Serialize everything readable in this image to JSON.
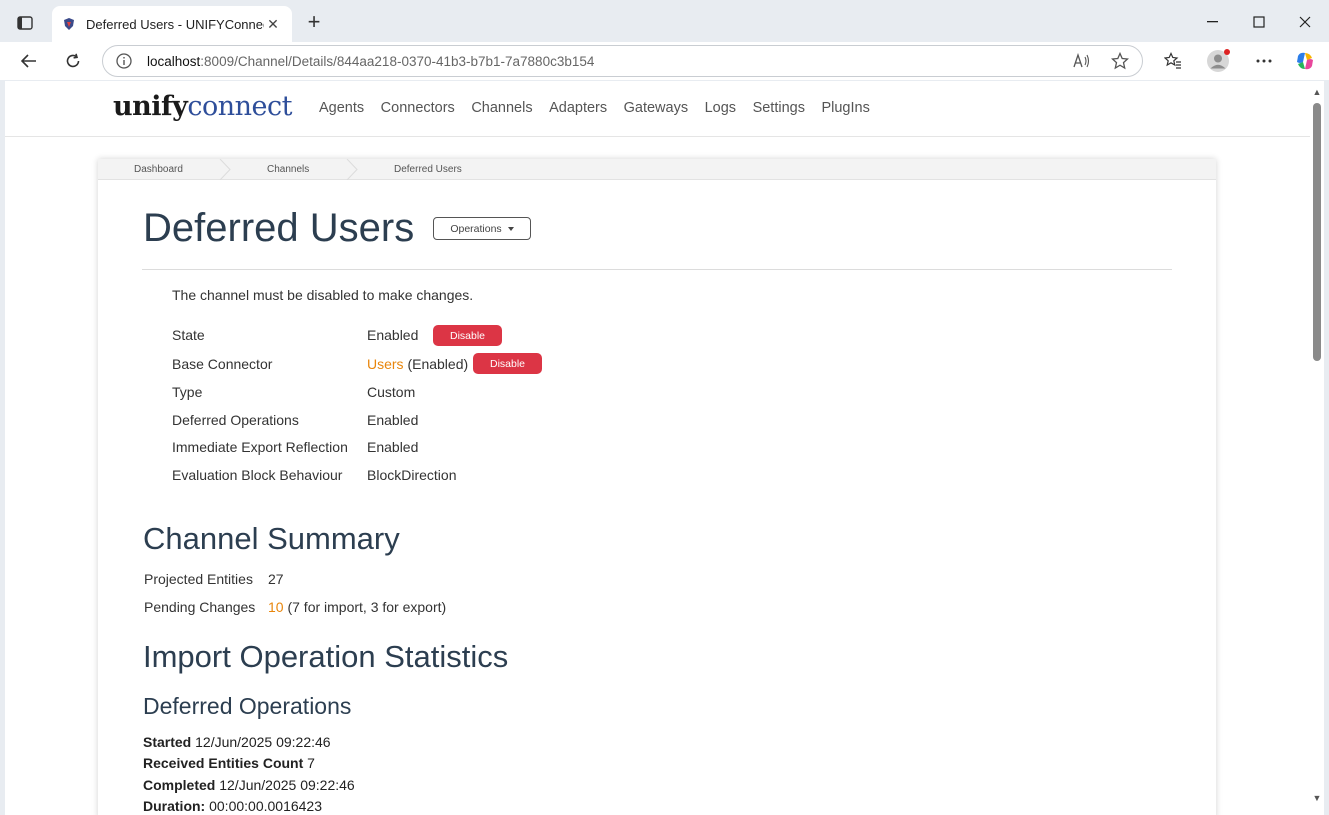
{
  "browser": {
    "tab_title": "Deferred Users - UNIFYConnect",
    "tab_close": "✕",
    "new_tab": "+",
    "url_host": "localhost",
    "url_path": ":8009/Channel/Details/844aa218-0370-41b3-b7b1-7a7880c3b154"
  },
  "site": {
    "logo_part1": "unify",
    "logo_part2": "connect",
    "nav": [
      "Agents",
      "Connectors",
      "Channels",
      "Adapters",
      "Gateways",
      "Logs",
      "Settings",
      "PlugIns"
    ]
  },
  "breadcrumb": [
    "Dashboard",
    "Channels",
    "Deferred Users"
  ],
  "page": {
    "title": "Deferred Users",
    "operations_label": "Operations",
    "notice": "The channel must be disabled to make changes."
  },
  "properties": {
    "state_label": "State",
    "state_value": "Enabled",
    "state_button": "Disable",
    "base_connector_label": "Base Connector",
    "base_connector_link": "Users",
    "base_connector_status": "(Enabled)",
    "base_connector_button": "Disable",
    "type_label": "Type",
    "type_value": "Custom",
    "deferred_ops_label": "Deferred Operations",
    "deferred_ops_value": "Enabled",
    "immediate_export_label": "Immediate Export Reflection",
    "immediate_export_value": "Enabled",
    "eval_block_label": "Evaluation Block Behaviour",
    "eval_block_value": "BlockDirection"
  },
  "summary": {
    "heading": "Channel Summary",
    "projected_label": "Projected Entities",
    "projected_value": "27",
    "pending_label": "Pending Changes",
    "pending_value": "10",
    "pending_detail": "(7 for import, 3 for export)"
  },
  "import_stats": {
    "heading": "Import Operation Statistics",
    "subheading": "Deferred Operations",
    "started_label": "Started",
    "started_value": "12/Jun/2025 09:22:46",
    "received_label": "Received Entities Count",
    "received_value": "7",
    "completed_label": "Completed",
    "completed_value": "12/Jun/2025 09:22:46",
    "duration_label": "Duration:",
    "duration_value": "00:00:00.0016423"
  }
}
